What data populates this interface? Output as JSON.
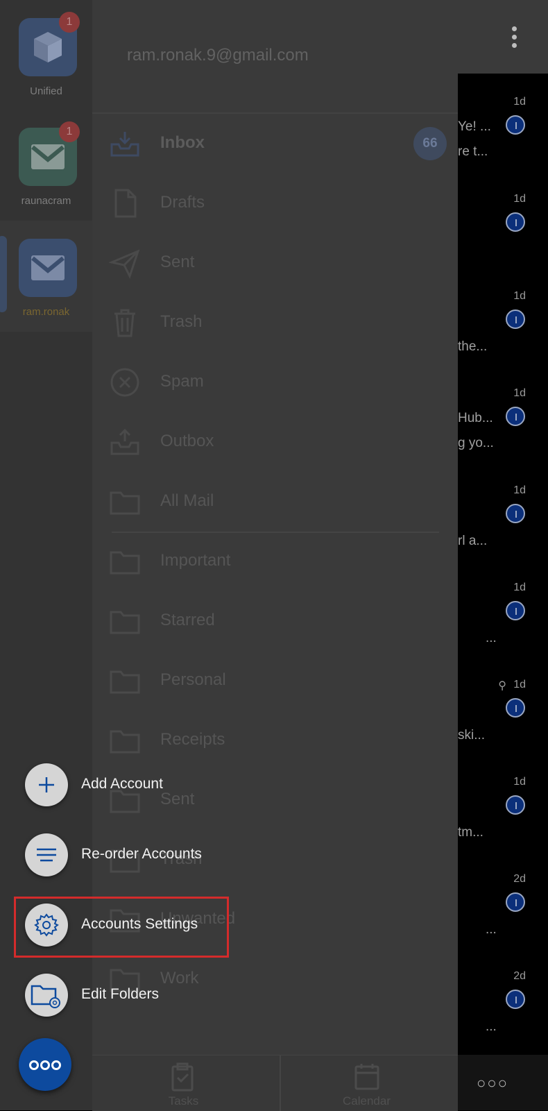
{
  "accounts": [
    {
      "label": "Unified",
      "badge": "1"
    },
    {
      "label": "raunacram",
      "badge": "1"
    },
    {
      "label": "ram.ronak",
      "badge": ""
    }
  ],
  "drawer": {
    "email": "ram.ronak.9@gmail.com",
    "folders": [
      {
        "label": "Inbox",
        "count": "66"
      },
      {
        "label": "Drafts"
      },
      {
        "label": "Sent"
      },
      {
        "label": "Trash"
      },
      {
        "label": "Spam"
      },
      {
        "label": "Outbox"
      },
      {
        "label": "All Mail"
      },
      {
        "label": "Important"
      },
      {
        "label": "Starred"
      },
      {
        "label": "Personal"
      },
      {
        "label": "Receipts"
      },
      {
        "label": "Sent"
      },
      {
        "label": "Trash"
      },
      {
        "label": "Unwanted"
      },
      {
        "label": "Work"
      }
    ],
    "tabs": [
      {
        "label": "Tasks"
      },
      {
        "label": "Calendar"
      }
    ]
  },
  "email_list": {
    "rows": [
      {
        "date": "1d",
        "snippets": [
          "Ye! ...",
          "re t..."
        ]
      },
      {
        "date": "1d",
        "snippets": []
      },
      {
        "date": "1d",
        "snippets": [
          "the..."
        ]
      },
      {
        "date": "1d",
        "snippets": [
          "Hub...",
          "g yo..."
        ]
      },
      {
        "date": "1d",
        "snippets": [
          "rl a..."
        ]
      },
      {
        "date": "1d",
        "snippets": [
          "..."
        ]
      },
      {
        "date": "1d",
        "snippets": [
          "ski..."
        ]
      },
      {
        "date": "1d",
        "snippets": [
          "tm..."
        ]
      },
      {
        "date": "2d",
        "snippets": [
          "..."
        ]
      },
      {
        "date": "2d",
        "snippets": [
          "..."
        ]
      }
    ]
  },
  "menu": {
    "items": [
      {
        "label": "Add Account"
      },
      {
        "label": "Re-order Accounts"
      },
      {
        "label": "Accounts Settings"
      },
      {
        "label": "Edit Folders"
      }
    ],
    "fab_label": "ooo"
  },
  "colors": {
    "accent": "#0d4a9e",
    "highlight": "#d42b2b"
  }
}
